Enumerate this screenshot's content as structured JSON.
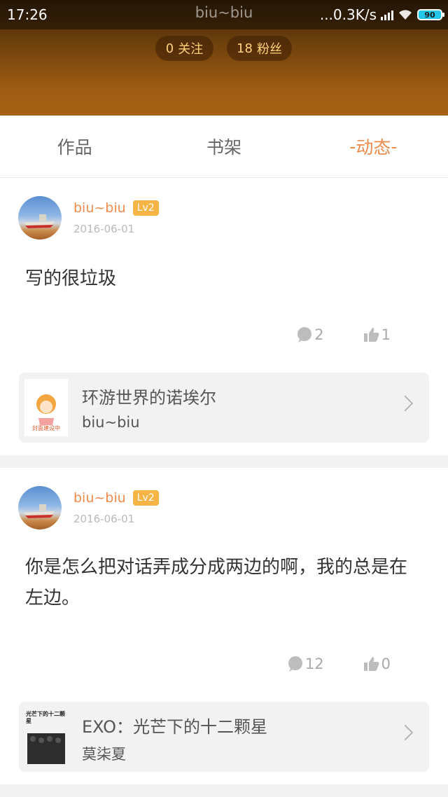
{
  "status_bar": {
    "time": "17:26",
    "title": "biu~biu",
    "network": "...0.3K/s",
    "battery": "90"
  },
  "profile": {
    "follow_count": "0",
    "follow_label": "关注",
    "fans_count": "18",
    "fans_label": "粉丝"
  },
  "tabs": [
    {
      "label": "作品",
      "active": false
    },
    {
      "label": "书架",
      "active": false
    },
    {
      "label": "动态",
      "active": true
    }
  ],
  "posts": [
    {
      "username": "biu~biu",
      "level": "Lv2",
      "date": "2016-06-01",
      "content": "写的很垃圾",
      "comments": "2",
      "likes": "1",
      "book": {
        "title": "环游世界的诺埃尔",
        "author": "biu~biu",
        "cover_text": "封面建设中"
      }
    },
    {
      "username": "biu~biu",
      "level": "Lv2",
      "date": "2016-06-01",
      "content": "你是怎么把对话弄成分成两边的啊，我的总是在左边。",
      "comments": "12",
      "likes": "0",
      "book": {
        "title": "EXO：光芒下的十二颗星",
        "author": "莫柒夏",
        "cover_text": "光芒下的十二颗星"
      }
    }
  ],
  "colors": {
    "accent": "#f08a4b",
    "level_badge": "#f5b443"
  }
}
